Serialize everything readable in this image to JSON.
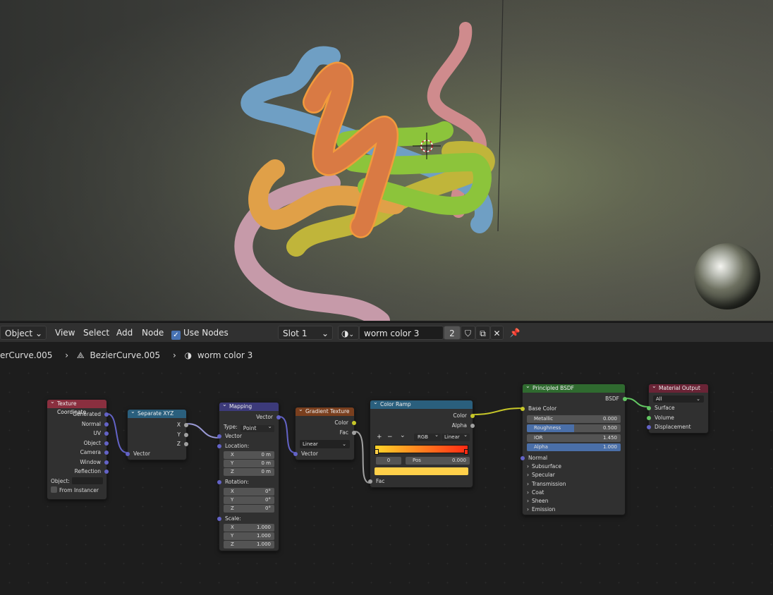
{
  "header": {
    "mode_dropdown": "Object",
    "menus": [
      "View",
      "Select",
      "Add",
      "Node"
    ],
    "use_nodes_label": "Use Nodes",
    "use_nodes_checked": true,
    "slot_dropdown": "Slot 1",
    "material_name": "worm color 3",
    "user_count": "2"
  },
  "breadcrumb": {
    "object": "erCurve.005",
    "data": "BezierCurve.005",
    "material": "worm color 3"
  },
  "colors": {
    "texture_coordinate_header": "#8a2f3f",
    "separate_xyz_header": "#2a5f7d",
    "mapping_header": "#3c3a7a",
    "gradient_texture_header": "#7a3f1e",
    "color_ramp_header": "#2a5f7d",
    "principled_header": "#2f6a2f",
    "material_output_header": "#6a2436",
    "vector_socket": "#6363c7",
    "color_socket": "#c7c729",
    "float_socket": "#a1a1a1",
    "shader_socket": "#63c763"
  },
  "nodes": {
    "texture_coordinate": {
      "title": "Texture Coordinate",
      "outputs": [
        "Generated",
        "Normal",
        "UV",
        "Object",
        "Camera",
        "Window",
        "Reflection"
      ],
      "object_label": "Object:",
      "from_instancer": "From Instancer"
    },
    "separate_xyz": {
      "title": "Separate XYZ",
      "outputs": [
        "X",
        "Y",
        "Z"
      ],
      "input": "Vector"
    },
    "mapping": {
      "title": "Mapping",
      "output": "Vector",
      "type_label": "Type:",
      "type_value": "Point",
      "vector_input": "Vector",
      "location_label": "Location:",
      "location": [
        {
          "axis": "X",
          "value": "0 m"
        },
        {
          "axis": "Y",
          "value": "0 m"
        },
        {
          "axis": "Z",
          "value": "0 m"
        }
      ],
      "rotation_label": "Rotation:",
      "rotation": [
        {
          "axis": "X",
          "value": "0°"
        },
        {
          "axis": "Y",
          "value": "0°"
        },
        {
          "axis": "Z",
          "value": "0°"
        }
      ],
      "scale_label": "Scale:",
      "scale": [
        {
          "axis": "X",
          "value": "1.000"
        },
        {
          "axis": "Y",
          "value": "1.000"
        },
        {
          "axis": "Z",
          "value": "1.000"
        }
      ]
    },
    "gradient_texture": {
      "title": "Gradient Texture",
      "outputs": [
        "Color",
        "Fac"
      ],
      "type_value": "Linear",
      "input": "Vector"
    },
    "color_ramp": {
      "title": "Color Ramp",
      "outputs": [
        "Color",
        "Alpha"
      ],
      "add_btn": "+",
      "remove_btn": "−",
      "menu_btn": "⌄",
      "color_mode": "RGB",
      "interpolation": "Linear",
      "stop_index": "0",
      "pos_label": "Pos",
      "pos_value": "0.000",
      "input": "Fac",
      "gradient_start": "#ffd42a",
      "gradient_end": "#ff2a14",
      "stop_color": "#ffd04a"
    },
    "principled_bsdf": {
      "title": "Principled BSDF",
      "output": "BSDF",
      "base_color": "Base Color",
      "fields": [
        {
          "label": "Metallic",
          "value": "0.000",
          "fill": 0.0
        },
        {
          "label": "Roughness",
          "value": "0.500",
          "fill": 0.5
        },
        {
          "label": "IOR",
          "value": "1.450",
          "fill": 0.0
        },
        {
          "label": "Alpha",
          "value": "1.000",
          "fill": 1.0
        }
      ],
      "normal": "Normal",
      "panels": [
        "Subsurface",
        "Specular",
        "Transmission",
        "Coat",
        "Sheen",
        "Emission"
      ]
    },
    "material_output": {
      "title": "Material Output",
      "target": "All",
      "inputs": [
        "Surface",
        "Volume",
        "Displacement"
      ]
    }
  }
}
